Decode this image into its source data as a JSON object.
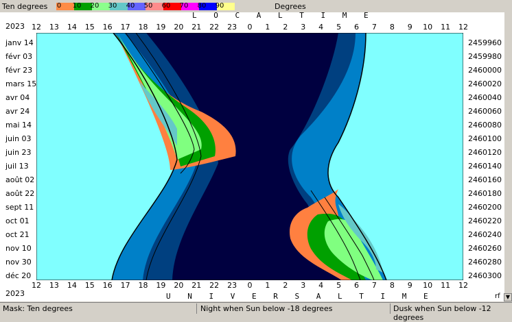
{
  "legend": {
    "title": "Ten degrees",
    "unit": "Degrees",
    "labels": [
      "0",
      "10",
      "20",
      "30",
      "40",
      "50",
      "60",
      "70",
      "80",
      "90"
    ],
    "colors": [
      "#ff8c46",
      "#00a000",
      "#8cff8c",
      "#64c8c8",
      "#6464ff",
      "#ff8c8c",
      "#ff0000",
      "#ff00ff",
      "#0000ff",
      "#ffff8c"
    ]
  },
  "top_axis": {
    "year": "2023",
    "title": "L O C A L   T I M E",
    "ticks": [
      "12",
      "13",
      "14",
      "15",
      "16",
      "17",
      "18",
      "19",
      "20",
      "21",
      "22",
      "23",
      "0",
      "1",
      "2",
      "3",
      "4",
      "5",
      "6",
      "7",
      "8",
      "9",
      "10",
      "11",
      "12"
    ]
  },
  "bottom_axis": {
    "year": "2023",
    "title": "U N I V E R S A L   T I M E",
    "ticks": [
      "12",
      "13",
      "14",
      "15",
      "16",
      "17",
      "18",
      "19",
      "20",
      "21",
      "22",
      "23",
      "0",
      "1",
      "2",
      "3",
      "4",
      "5",
      "6",
      "7",
      "8",
      "9",
      "10",
      "11",
      "12"
    ]
  },
  "left_axis": [
    "janv 14",
    "févr 03",
    "févr 23",
    "mars 15",
    "avr 04",
    "avr 24",
    "mai 14",
    "juin 03",
    "juin 23",
    "juil 13",
    "août 02",
    "août 22",
    "sept 11",
    "oct 01",
    "oct 21",
    "nov 10",
    "nov 30",
    "déc 20"
  ],
  "right_axis": [
    "2459960",
    "2459980",
    "2460000",
    "2460020",
    "2460040",
    "2460060",
    "2460080",
    "2460100",
    "2460120",
    "2460140",
    "2460160",
    "2460180",
    "2460200",
    "2460220",
    "2460240",
    "2460260",
    "2460280",
    "2460300"
  ],
  "corner_mark": "rf",
  "colors": {
    "day": "#80ffff",
    "civil": "#0080c8",
    "nautical": "#004080",
    "night": "#000040",
    "band_orange": "#ff8040",
    "band_green": "#00a000",
    "band_lightgreen": "#80ff80",
    "band_teal": "#64c8c8"
  },
  "status": {
    "mask": "Mask:  Ten degrees",
    "night": "Night when Sun below -18 degrees",
    "dusk": "Dusk when Sun below -12 degrees"
  }
}
